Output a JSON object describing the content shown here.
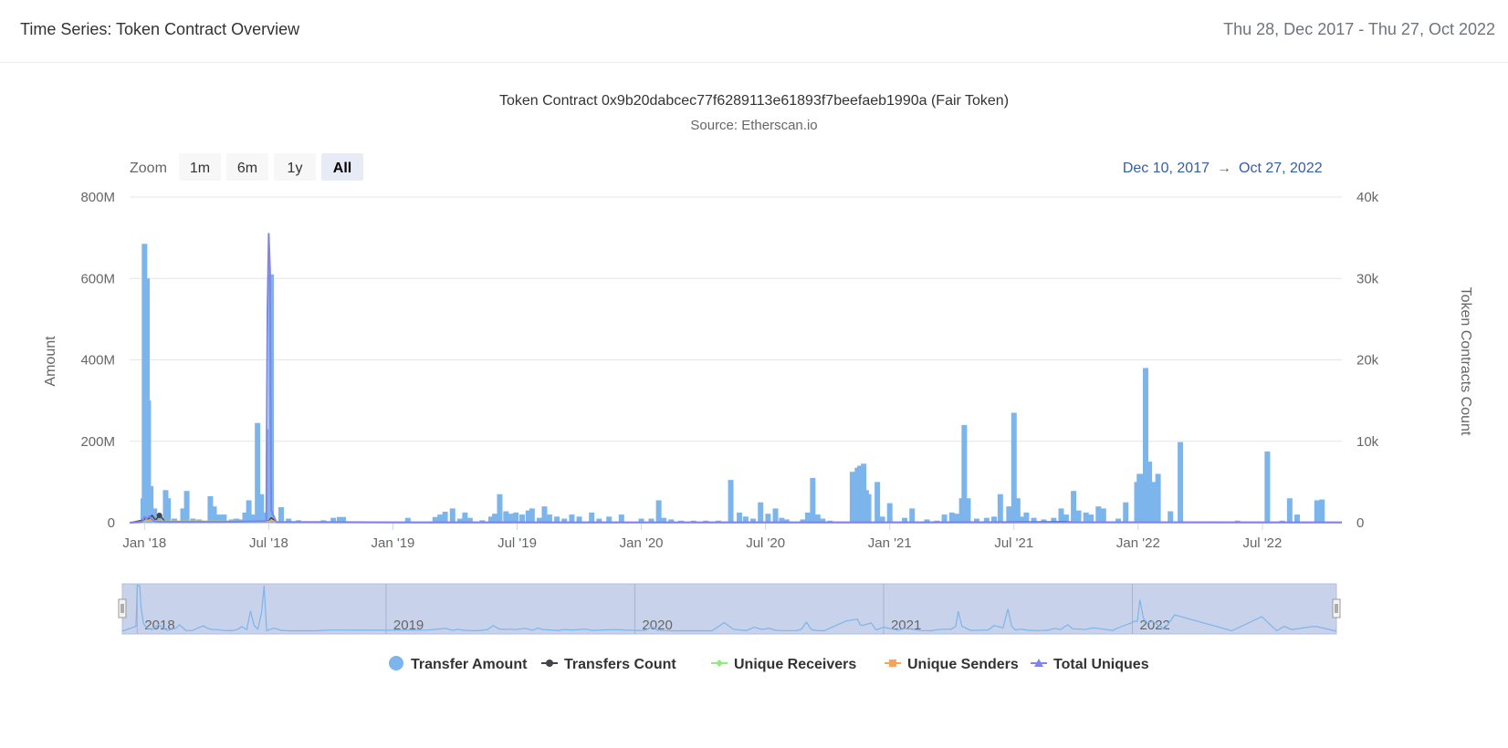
{
  "header": {
    "title": "Time Series: Token Contract Overview",
    "range": "Thu 28, Dec 2017 - Thu 27, Oct 2022"
  },
  "chart_data": {
    "type": "bar",
    "title": "Token Contract 0x9b20dabcec77f6289113e61893f7beefaeb1990a (Fair Token)",
    "subtitle": "Source: Etherscan.io",
    "ylabel": "Amount",
    "y2label": "Token Contracts Count",
    "ylim": [
      0,
      800
    ],
    "y2lim": [
      0,
      40000
    ],
    "yticks": [
      "0",
      "200M",
      "400M",
      "600M",
      "800M"
    ],
    "y2ticks": [
      "0",
      "10k",
      "20k",
      "30k",
      "40k"
    ],
    "xlim": [
      2017.94,
      2022.82
    ],
    "xticks": [
      {
        "label": "Jan '18",
        "x": 2018.0
      },
      {
        "label": "Jul '18",
        "x": 2018.5
      },
      {
        "label": "Jan '19",
        "x": 2019.0
      },
      {
        "label": "Jul '19",
        "x": 2019.5
      },
      {
        "label": "Jan '20",
        "x": 2020.0
      },
      {
        "label": "Jul '20",
        "x": 2020.5
      },
      {
        "label": "Jan '21",
        "x": 2021.0
      },
      {
        "label": "Jul '21",
        "x": 2021.5
      },
      {
        "label": "Jan '22",
        "x": 2022.0
      },
      {
        "label": "Jul '22",
        "x": 2022.5
      }
    ],
    "zoom": {
      "label": "Zoom",
      "buttons": [
        "1m",
        "6m",
        "1y",
        "All"
      ],
      "selected": "All"
    },
    "date_range": {
      "from": "Dec 10, 2017",
      "arrow": "→",
      "to": "Oct 27, 2022"
    },
    "navigator": {
      "labels": [
        {
          "label": "2018",
          "x": 2018.0
        },
        {
          "label": "2019",
          "x": 2019.0
        },
        {
          "label": "2020",
          "x": 2020.0
        },
        {
          "label": "2021",
          "x": 2021.0
        },
        {
          "label": "2022",
          "x": 2022.0
        }
      ]
    },
    "colors": {
      "transfer_amount": "#7cb5ec",
      "transfers_count": "#434348",
      "unique_receivers": "#90ed7d",
      "unique_senders": "#f7a35c",
      "total_uniques": "#8085e9"
    },
    "series": [
      {
        "name": "Transfer Amount",
        "type": "bar",
        "axis": "left",
        "points": [
          [
            2017.995,
            60
          ],
          [
            2018.0,
            685
          ],
          [
            2018.01,
            600
          ],
          [
            2018.015,
            300
          ],
          [
            2018.025,
            90
          ],
          [
            2018.04,
            35
          ],
          [
            2018.06,
            20
          ],
          [
            2018.085,
            80
          ],
          [
            2018.095,
            60
          ],
          [
            2018.12,
            10
          ],
          [
            2018.155,
            35
          ],
          [
            2018.17,
            78
          ],
          [
            2018.195,
            10
          ],
          [
            2018.22,
            8
          ],
          [
            2018.265,
            65
          ],
          [
            2018.28,
            40
          ],
          [
            2018.3,
            20
          ],
          [
            2018.32,
            20
          ],
          [
            2018.35,
            8
          ],
          [
            2018.37,
            10
          ],
          [
            2018.385,
            8
          ],
          [
            2018.405,
            25
          ],
          [
            2018.42,
            55
          ],
          [
            2018.44,
            20
          ],
          [
            2018.455,
            245
          ],
          [
            2018.47,
            70
          ],
          [
            2018.485,
            25
          ],
          [
            2018.5,
            230
          ],
          [
            2018.51,
            610
          ],
          [
            2018.52,
            8
          ],
          [
            2018.55,
            38
          ],
          [
            2018.58,
            10
          ],
          [
            2018.62,
            6
          ],
          [
            2018.72,
            6
          ],
          [
            2018.76,
            12
          ],
          [
            2018.785,
            14
          ],
          [
            2018.8,
            14
          ],
          [
            2019.06,
            12
          ],
          [
            2019.17,
            14
          ],
          [
            2019.19,
            20
          ],
          [
            2019.21,
            27
          ],
          [
            2019.24,
            35
          ],
          [
            2019.27,
            10
          ],
          [
            2019.29,
            25
          ],
          [
            2019.31,
            12
          ],
          [
            2019.36,
            6
          ],
          [
            2019.395,
            15
          ],
          [
            2019.41,
            22
          ],
          [
            2019.43,
            70
          ],
          [
            2019.455,
            28
          ],
          [
            2019.475,
            22
          ],
          [
            2019.495,
            25
          ],
          [
            2019.52,
            20
          ],
          [
            2019.545,
            30
          ],
          [
            2019.56,
            35
          ],
          [
            2019.59,
            12
          ],
          [
            2019.61,
            40
          ],
          [
            2019.63,
            20
          ],
          [
            2019.66,
            15
          ],
          [
            2019.69,
            10
          ],
          [
            2019.72,
            20
          ],
          [
            2019.75,
            15
          ],
          [
            2019.8,
            25
          ],
          [
            2019.83,
            10
          ],
          [
            2019.87,
            15
          ],
          [
            2019.92,
            20
          ],
          [
            2020.0,
            10
          ],
          [
            2020.04,
            10
          ],
          [
            2020.07,
            55
          ],
          [
            2020.09,
            12
          ],
          [
            2020.12,
            8
          ],
          [
            2020.16,
            5
          ],
          [
            2020.21,
            5
          ],
          [
            2020.26,
            5
          ],
          [
            2020.31,
            5
          ],
          [
            2020.36,
            105
          ],
          [
            2020.395,
            25
          ],
          [
            2020.42,
            15
          ],
          [
            2020.45,
            10
          ],
          [
            2020.48,
            50
          ],
          [
            2020.51,
            22
          ],
          [
            2020.54,
            35
          ],
          [
            2020.565,
            12
          ],
          [
            2020.585,
            8
          ],
          [
            2020.65,
            8
          ],
          [
            2020.67,
            25
          ],
          [
            2020.69,
            110
          ],
          [
            2020.71,
            20
          ],
          [
            2020.73,
            10
          ],
          [
            2020.76,
            5
          ],
          [
            2020.85,
            125
          ],
          [
            2020.87,
            135
          ],
          [
            2020.88,
            140
          ],
          [
            2020.895,
            145
          ],
          [
            2020.905,
            80
          ],
          [
            2020.915,
            70
          ],
          [
            2020.95,
            100
          ],
          [
            2020.97,
            15
          ],
          [
            2021.0,
            48
          ],
          [
            2021.06,
            12
          ],
          [
            2021.09,
            35
          ],
          [
            2021.15,
            8
          ],
          [
            2021.19,
            5
          ],
          [
            2021.22,
            20
          ],
          [
            2021.25,
            25
          ],
          [
            2021.27,
            22
          ],
          [
            2021.29,
            60
          ],
          [
            2021.3,
            240
          ],
          [
            2021.315,
            60
          ],
          [
            2021.35,
            10
          ],
          [
            2021.39,
            12
          ],
          [
            2021.42,
            15
          ],
          [
            2021.445,
            70
          ],
          [
            2021.48,
            40
          ],
          [
            2021.5,
            270
          ],
          [
            2021.515,
            60
          ],
          [
            2021.53,
            15
          ],
          [
            2021.55,
            25
          ],
          [
            2021.58,
            12
          ],
          [
            2021.62,
            8
          ],
          [
            2021.66,
            12
          ],
          [
            2021.69,
            35
          ],
          [
            2021.71,
            20
          ],
          [
            2021.74,
            78
          ],
          [
            2021.76,
            30
          ],
          [
            2021.79,
            25
          ],
          [
            2021.81,
            20
          ],
          [
            2021.84,
            40
          ],
          [
            2021.86,
            35
          ],
          [
            2021.92,
            10
          ],
          [
            2021.95,
            50
          ],
          [
            2021.995,
            100
          ],
          [
            2022.005,
            120
          ],
          [
            2022.02,
            120
          ],
          [
            2022.03,
            380
          ],
          [
            2022.045,
            150
          ],
          [
            2022.06,
            100
          ],
          [
            2022.08,
            120
          ],
          [
            2022.13,
            28
          ],
          [
            2022.17,
            198
          ],
          [
            2022.4,
            5
          ],
          [
            2022.52,
            175
          ],
          [
            2022.58,
            5
          ],
          [
            2022.61,
            60
          ],
          [
            2022.64,
            20
          ],
          [
            2022.72,
            55
          ],
          [
            2022.74,
            57
          ]
        ]
      },
      {
        "name": "Transfers Count",
        "type": "line",
        "axis": "right",
        "points": [
          [
            2017.94,
            0
          ],
          [
            2017.995,
            300
          ],
          [
            2018.005,
            600
          ],
          [
            2018.015,
            400
          ],
          [
            2018.03,
            900
          ],
          [
            2018.045,
            300
          ],
          [
            2018.06,
            1000
          ],
          [
            2018.08,
            200
          ],
          [
            2018.12,
            100
          ],
          [
            2018.3,
            80
          ],
          [
            2018.5,
            200
          ],
          [
            2018.51,
            600
          ],
          [
            2018.53,
            100
          ],
          [
            2019.0,
            40
          ],
          [
            2020.0,
            30
          ],
          [
            2021.0,
            40
          ],
          [
            2021.7,
            120
          ],
          [
            2021.74,
            80
          ],
          [
            2022.0,
            60
          ],
          [
            2022.5,
            40
          ],
          [
            2022.82,
            40
          ]
        ]
      },
      {
        "name": "Unique Receivers",
        "type": "line",
        "axis": "right",
        "points": [
          [
            2017.94,
            0
          ],
          [
            2018.0,
            150
          ],
          [
            2018.02,
            350
          ],
          [
            2018.06,
            200
          ],
          [
            2018.5,
            150
          ],
          [
            2018.51,
            350
          ],
          [
            2018.53,
            60
          ],
          [
            2019.0,
            20
          ],
          [
            2020.0,
            15
          ],
          [
            2021.0,
            20
          ],
          [
            2022.0,
            25
          ],
          [
            2022.82,
            15
          ]
        ]
      },
      {
        "name": "Unique Senders",
        "type": "line",
        "axis": "right",
        "points": [
          [
            2017.94,
            0
          ],
          [
            2018.0,
            120
          ],
          [
            2018.02,
            300
          ],
          [
            2018.06,
            180
          ],
          [
            2018.5,
            130
          ],
          [
            2018.51,
            300
          ],
          [
            2018.53,
            50
          ],
          [
            2019.0,
            15
          ],
          [
            2020.0,
            12
          ],
          [
            2021.0,
            18
          ],
          [
            2022.0,
            20
          ],
          [
            2022.82,
            12
          ]
        ]
      },
      {
        "name": "Total Uniques",
        "type": "line",
        "axis": "right",
        "points": [
          [
            2017.94,
            0
          ],
          [
            2017.99,
            100
          ],
          [
            2018.0,
            700
          ],
          [
            2018.01,
            500
          ],
          [
            2018.02,
            800
          ],
          [
            2018.03,
            400
          ],
          [
            2018.04,
            200
          ],
          [
            2018.06,
            100
          ],
          [
            2018.3,
            100
          ],
          [
            2018.49,
            200
          ],
          [
            2018.495,
            26000
          ],
          [
            2018.5,
            35500
          ],
          [
            2018.505,
            31000
          ],
          [
            2018.51,
            1500
          ],
          [
            2018.53,
            100
          ],
          [
            2019.0,
            50
          ],
          [
            2020.0,
            40
          ],
          [
            2021.0,
            50
          ],
          [
            2022.0,
            60
          ],
          [
            2022.82,
            40
          ]
        ]
      }
    ],
    "legend": [
      {
        "name": "Transfer Amount",
        "marker": "circle",
        "color": "#7cb5ec"
      },
      {
        "name": "Transfers Count",
        "marker": "dot-line",
        "color": "#434348"
      },
      {
        "name": "Unique Receivers",
        "marker": "diamond-line",
        "color": "#90ed7d"
      },
      {
        "name": "Unique Senders",
        "marker": "square-line",
        "color": "#f7a35c"
      },
      {
        "name": "Total Uniques",
        "marker": "triangle-line",
        "color": "#8085e9"
      }
    ]
  }
}
